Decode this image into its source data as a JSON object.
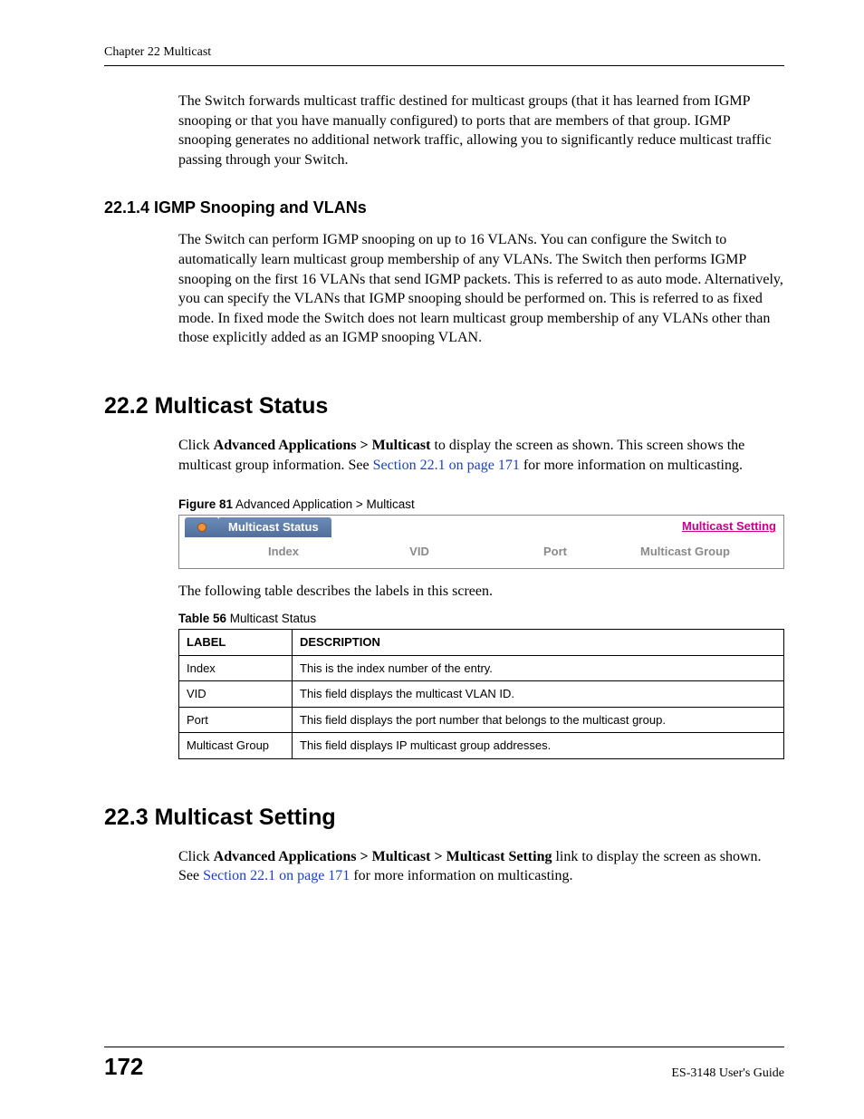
{
  "header": {
    "chapter": "Chapter 22 Multicast"
  },
  "intro_para": "The Switch forwards multicast traffic destined for multicast groups (that it has learned from IGMP snooping or that you have manually configured) to ports that are members of that group. IGMP snooping generates no additional network traffic, allowing you to significantly reduce multicast traffic passing through your Switch.",
  "s2214": {
    "title": "22.1.4  IGMP Snooping and VLANs",
    "para": "The Switch can perform IGMP snooping on up to 16 VLANs. You can configure the Switch to automatically learn multicast group membership of any VLANs. The Switch then performs IGMP snooping on the first 16 VLANs that send IGMP packets. This is referred to as auto mode. Alternatively, you can specify the VLANs that IGMP snooping should be performed on. This is referred to as fixed mode. In fixed mode the Switch does not learn multicast group membership of any VLANs other than those explicitly added as an IGMP snooping VLAN."
  },
  "s222": {
    "title": "22.2  Multicast Status",
    "para_pre": "Click ",
    "para_bold": "Advanced Applications > Multicast",
    "para_mid": " to display the screen as shown. This screen shows the multicast group information. See ",
    "para_link": "Section 22.1 on page 171",
    "para_post": " for more information on multicasting.",
    "figure": {
      "num": "Figure 81",
      "caption": "   Advanced Application > Multicast",
      "tab_label": "Multicast Status",
      "right_link": "Multicast Setting",
      "cols": [
        "Index",
        "VID",
        "Port",
        "Multicast Group"
      ]
    },
    "table_intro": "The following table describes the labels in this screen.",
    "table": {
      "num": "Table 56",
      "caption": "   Multicast Status",
      "headers": [
        "LABEL",
        "DESCRIPTION"
      ],
      "rows": [
        [
          "Index",
          "This is the index number of the entry."
        ],
        [
          "VID",
          "This field displays the multicast VLAN ID."
        ],
        [
          "Port",
          "This field displays the port number that belongs to the multicast group."
        ],
        [
          "Multicast Group",
          "This field displays IP multicast group addresses."
        ]
      ]
    }
  },
  "s223": {
    "title": "22.3  Multicast Setting",
    "para_pre": "Click ",
    "para_bold": "Advanced Applications > Multicast > Multicast Setting",
    "para_mid": " link to display the screen as shown. See ",
    "para_link": "Section 22.1 on page 171",
    "para_post": " for more information on multicasting."
  },
  "footer": {
    "page": "172",
    "guide": "ES-3148 User's Guide"
  }
}
